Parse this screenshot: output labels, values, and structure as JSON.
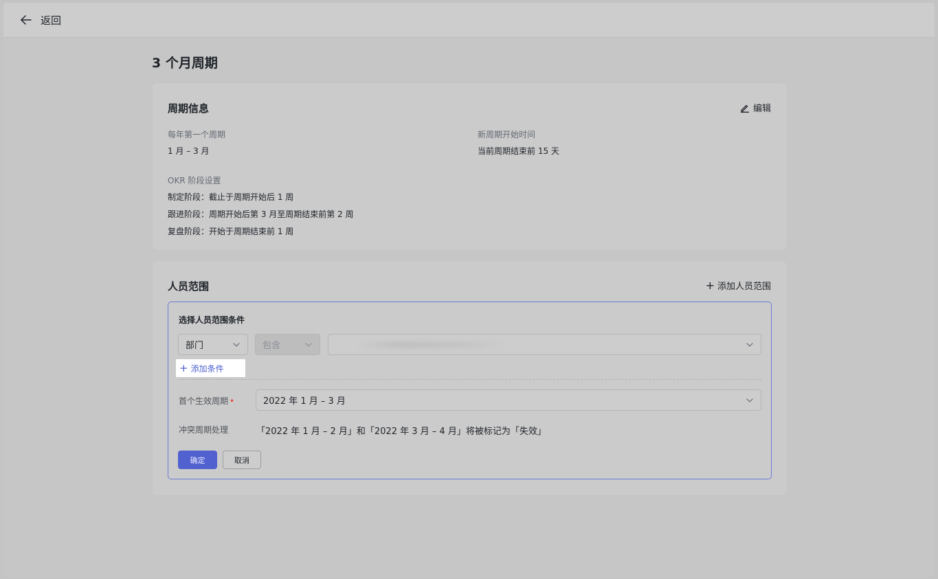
{
  "topbar": {
    "back_label": "返回"
  },
  "page": {
    "title": "3 个月周期"
  },
  "info": {
    "title": "周期信息",
    "edit_label": "编辑",
    "first_cycle_label": "每年第一个周期",
    "first_cycle_value": "1 月 – 3 月",
    "new_cycle_label": "新周期开始时间",
    "new_cycle_value": "当前周期结束前 15 天",
    "okr_label": "OKR 阶段设置",
    "stages": [
      "制定阶段：截止于周期开始后 1 周",
      "跟进阶段：周期开始后第 3 月至周期结束前第 2 周",
      "复盘阶段：开始于周期结束前 1 周"
    ]
  },
  "scope": {
    "title": "人员范围",
    "add_scope_label": "添加人员范围",
    "editor": {
      "title": "选择人员范围条件",
      "field_select": "部门",
      "operator_select": "包含",
      "value_select": "",
      "add_condition_label": "添加条件",
      "first_cycle_label": "首个生效周期",
      "required_mark": "•",
      "first_cycle_value": "2022 年 1 月 – 3 月",
      "conflict_label": "冲突周期处理",
      "conflict_text": "「2022 年 1 月 – 2 月」和「2022 年 3 月 – 4 月」将被标记为「失效」",
      "confirm_label": "确定",
      "cancel_label": "取消"
    }
  },
  "colors": {
    "accent": "#5161cf",
    "link": "#4f61d1",
    "required": "#e5483c",
    "focus_border": "#6b7bd6"
  }
}
